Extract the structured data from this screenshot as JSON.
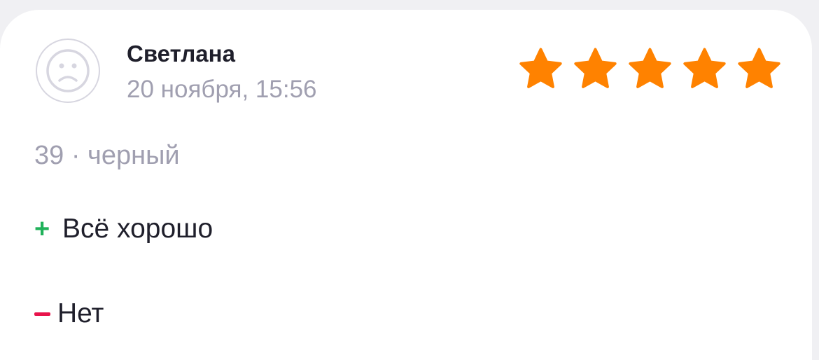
{
  "review": {
    "author": "Светлана",
    "date": "20 ноября, 15:56",
    "rating": 5,
    "max_rating": 5,
    "variant": "39 · черный",
    "pros_label": "Всё хорошо",
    "cons_label": "Нет",
    "pros_mark": "+",
    "avatar_icon": "sad-face-icon"
  },
  "colors": {
    "star": "#ff8200",
    "pros_mark": "#20b15a",
    "cons_mark": "#e8134b",
    "avatar_stroke": "#d7d6e0"
  }
}
